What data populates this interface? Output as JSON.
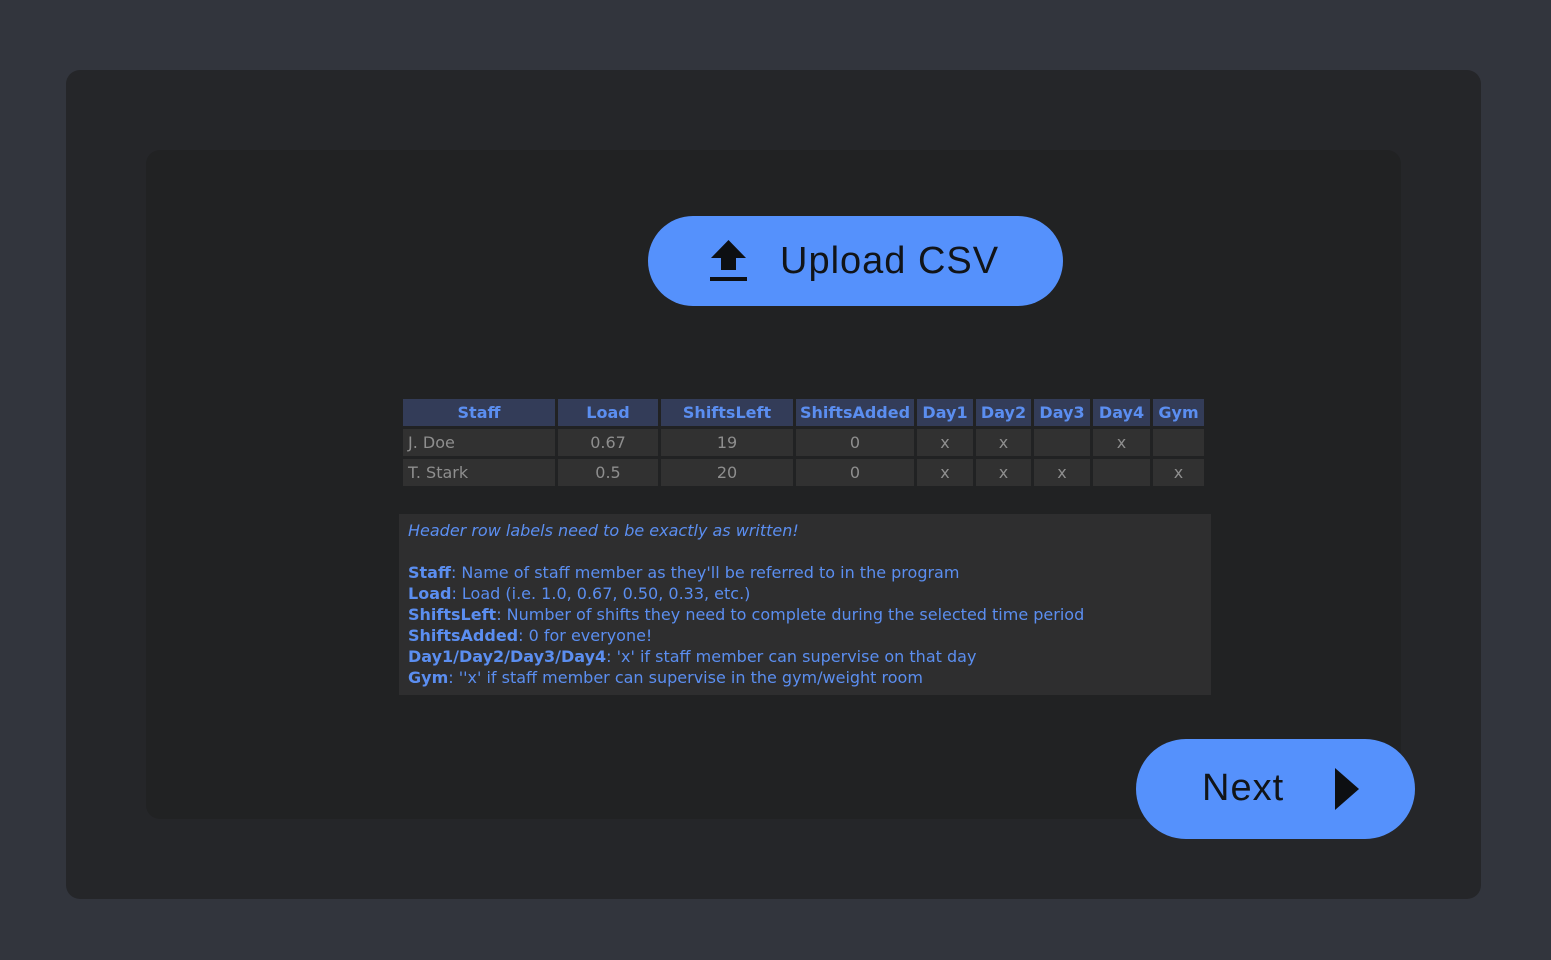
{
  "upload": {
    "label": "Upload CSV",
    "icon": "upload-icon"
  },
  "table": {
    "headers": [
      "Staff",
      "Load",
      "ShiftsLeft",
      "ShiftsAdded",
      "Day1",
      "Day2",
      "Day3",
      "Day4",
      "Gym"
    ],
    "rows": [
      [
        "J. Doe",
        "0.67",
        "19",
        "0",
        "x",
        "x",
        "",
        "x",
        ""
      ],
      [
        "T. Stark",
        "0.5",
        "20",
        "0",
        "x",
        "x",
        "x",
        "",
        "x"
      ]
    ]
  },
  "info": {
    "note": "Header row labels need to be exactly as written!",
    "lines": [
      {
        "key": "Staff",
        "text": ": Name of staff member as they'll be referred to in the program"
      },
      {
        "key": "Load",
        "text": ": Load (i.e. 1.0, 0.67, 0.50, 0.33, etc.)"
      },
      {
        "key": "ShiftsLeft",
        "text": ": Number of shifts they need to complete during the selected time period"
      },
      {
        "key": "ShiftsAdded",
        "text": ": 0 for everyone!"
      },
      {
        "key": "Day1/Day2/Day3/Day4",
        "text": ": 'x' if staff member can supervise on that day"
      },
      {
        "key": "Gym",
        "text": ": ''x' if staff member can supervise in the gym/weight room"
      }
    ]
  },
  "next": {
    "label": "Next",
    "icon": "play-arrow-icon"
  },
  "colors": {
    "accent": "#5591fc",
    "background": "#32353d",
    "panel_outer": "#252629",
    "panel_inner": "#212223",
    "text_accent": "#5b8ef0"
  }
}
